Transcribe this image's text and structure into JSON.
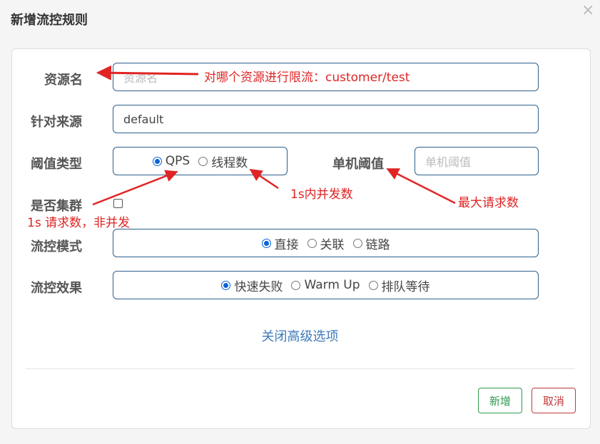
{
  "dialog": {
    "title": "新增流控规则",
    "close_glyph": "×"
  },
  "form": {
    "resource": {
      "label": "资源名",
      "placeholder": "资源名",
      "value": ""
    },
    "limit_app": {
      "label": "针对来源",
      "value": "default"
    },
    "grade": {
      "label": "阈值类型",
      "options": [
        {
          "label": "QPS",
          "checked": true
        },
        {
          "label": "线程数",
          "checked": false
        }
      ]
    },
    "count": {
      "label": "单机阈值",
      "placeholder": "单机阈值",
      "value": ""
    },
    "cluster": {
      "label": "是否集群",
      "checked": false
    },
    "strategy": {
      "label": "流控模式",
      "options": [
        {
          "label": "直接",
          "checked": true
        },
        {
          "label": "关联",
          "checked": false
        },
        {
          "label": "链路",
          "checked": false
        }
      ]
    },
    "control_behavior": {
      "label": "流控效果",
      "options": [
        {
          "label": "快速失败",
          "checked": true
        },
        {
          "label": "Warm Up",
          "checked": false
        },
        {
          "label": "排队等待",
          "checked": false
        }
      ]
    },
    "advanced_link": "关闭高级选项"
  },
  "buttons": {
    "add": "新增",
    "cancel": "取消"
  },
  "annotations": {
    "resource_note": "对哪个资源进行限流：customer/test",
    "thread_note": "1s内并发数",
    "qps_note": "1s  请求数，非并发",
    "threshold_note": "最大请求数"
  },
  "colors": {
    "annotation": "#e02424",
    "input_border": "#2e5f8a",
    "link": "#3e7ab8",
    "add_button": "#2e9a4e",
    "cancel_button": "#c0393b",
    "radio_checked": "#0a64d8"
  }
}
